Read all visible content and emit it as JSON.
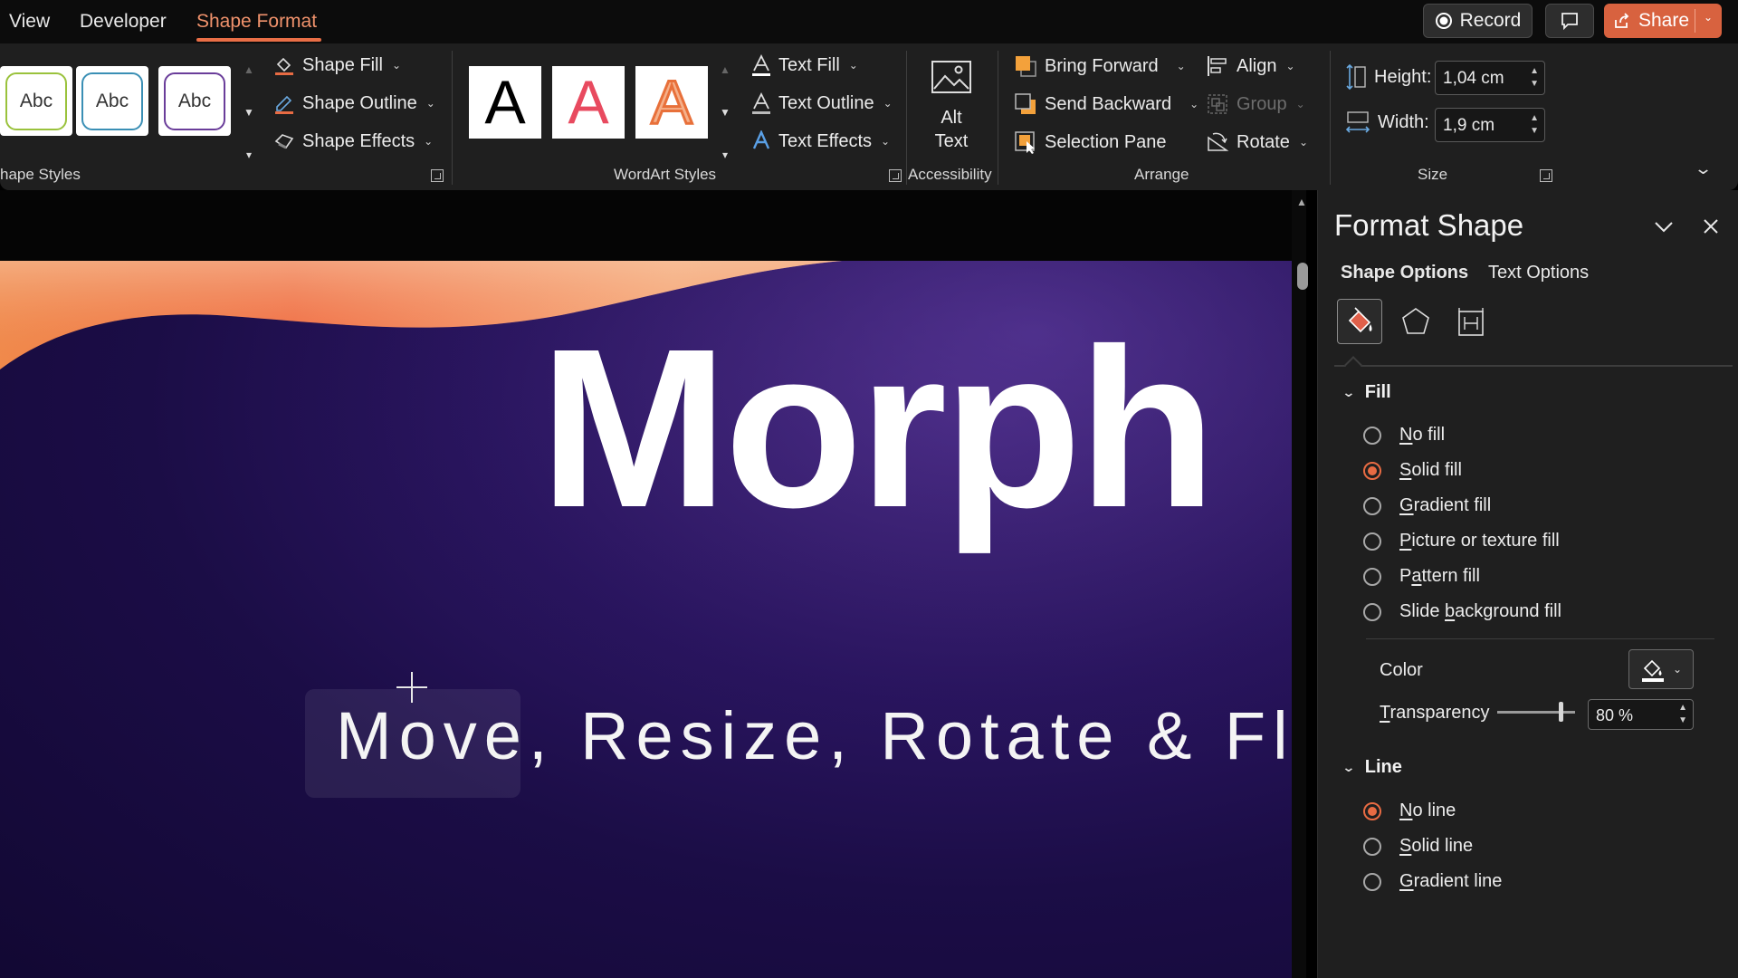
{
  "tabs": {
    "view": "View",
    "developer": "Developer",
    "shape_format": "Shape Format",
    "active": "Shape Format"
  },
  "header_buttons": {
    "record": "Record",
    "share": "Share"
  },
  "ribbon": {
    "shape_styles": {
      "label": "hape Styles",
      "presets": [
        "Abc",
        "Abc",
        "Abc"
      ],
      "shape_fill": "Shape Fill",
      "shape_outline": "Shape Outline",
      "shape_effects": "Shape Effects"
    },
    "wordart_styles": {
      "label": "WordArt Styles",
      "presets": [
        "A",
        "A",
        "A"
      ],
      "text_fill": "Text Fill",
      "text_outline": "Text Outline",
      "text_effects": "Text Effects"
    },
    "accessibility": {
      "label": "Accessibility",
      "alt_text_line1": "Alt",
      "alt_text_line2": "Text"
    },
    "arrange": {
      "label": "Arrange",
      "bring_forward": "Bring Forward",
      "send_backward": "Send Backward",
      "selection_pane": "Selection Pane",
      "align": "Align",
      "group": "Group",
      "rotate": "Rotate"
    },
    "size": {
      "label": "Size",
      "height_label": "Height:",
      "height_value": "1,04 cm",
      "width_label": "Width:",
      "width_value": "1,9 cm"
    }
  },
  "slide": {
    "title": "Morph",
    "subtitle": "Move, Resize, Rotate & Flip"
  },
  "format_pane": {
    "title": "Format Shape",
    "tabs": [
      "Shape Options",
      "Text Options"
    ],
    "active_tab": "Shape Options",
    "fill": {
      "header": "Fill",
      "options": [
        {
          "pre": "",
          "key": "N",
          "post": "o fill",
          "selected": false
        },
        {
          "pre": "",
          "key": "S",
          "post": "olid fill",
          "selected": true
        },
        {
          "pre": "",
          "key": "G",
          "post": "radient fill",
          "selected": false
        },
        {
          "pre": "",
          "key": "P",
          "post": "icture or texture fill",
          "selected": false
        },
        {
          "pre": "P",
          "key": "a",
          "post": "ttern fill",
          "selected": false
        },
        {
          "pre": "Slide ",
          "key": "b",
          "post": "ackground fill",
          "selected": false
        }
      ],
      "color_label": "Color",
      "transparency_label": "Transparency",
      "transparency_value": "80 %",
      "transparency_level": 0.8
    },
    "line": {
      "header": "Line",
      "options": [
        {
          "pre": "",
          "key": "N",
          "post": "o line",
          "selected": true
        },
        {
          "pre": "",
          "key": "S",
          "post": "olid line",
          "selected": false
        },
        {
          "pre": "",
          "key": "G",
          "post": "radient line",
          "selected": false
        }
      ]
    }
  },
  "colors": {
    "accent": "#e96e46",
    "ribbon_bg": "#1f1f1f",
    "slide_bg": "#1b0d46",
    "wave_orange": "#f07a45"
  }
}
